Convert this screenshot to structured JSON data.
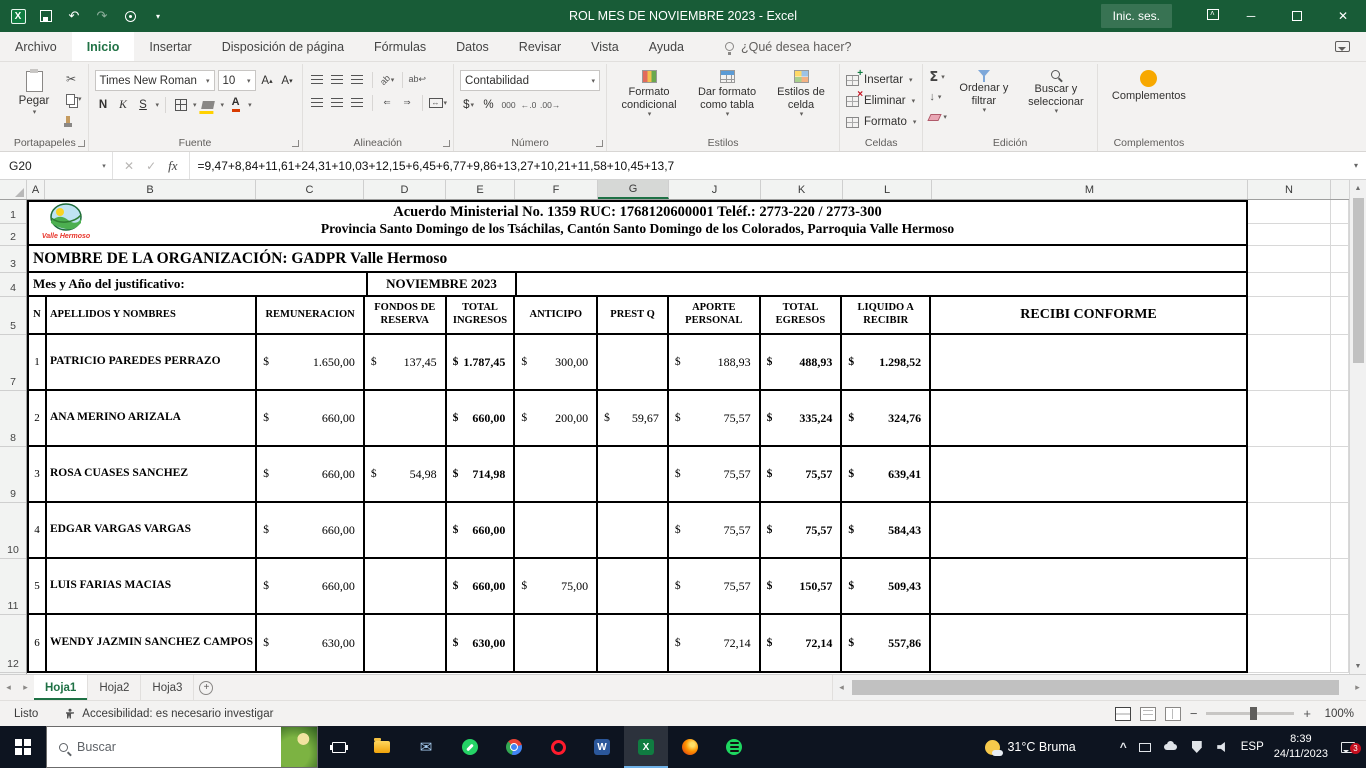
{
  "colors": {
    "excel_dark_green": "#185c37",
    "excel_green": "#217346",
    "taskbar_bg": "#0d1420",
    "addins_dot": "#f7a800"
  },
  "title_bar": {
    "title": "ROL MES DE NOVIEMBRE 2023  -  Excel",
    "sign_in": "Inic. ses."
  },
  "ribbon_tabs": {
    "items": [
      "Archivo",
      "Inicio",
      "Insertar",
      "Disposición de página",
      "Fórmulas",
      "Datos",
      "Revisar",
      "Vista",
      "Ayuda"
    ],
    "active": "Inicio",
    "tell_me": "¿Qué desea hacer?"
  },
  "ribbon": {
    "paste": "Pegar",
    "clipboard_label": "Portapapeles",
    "font_name": "Times New Roman",
    "font_size": "10",
    "bold": "N",
    "italic": "K",
    "underline": "S",
    "font_label": "Fuente",
    "wrap": "ab",
    "alignment_label": "Alineación",
    "number_format": "Contabilidad",
    "currency": "$",
    "percent": "%",
    "thousands": "000",
    "inc_decimal": "←.0",
    "dec_decimal": ".00→",
    "number_label": "Número",
    "conditional_format": "Formato condicional",
    "format_as_table": "Dar formato como tabla",
    "cell_styles": "Estilos de celda",
    "styles_label": "Estilos",
    "insert": "Insertar",
    "delete": "Eliminar",
    "format": "Formato",
    "cells_label": "Celdas",
    "sort_filter": "Ordenar y filtrar",
    "find_select": "Buscar y seleccionar",
    "editing_label": "Edición",
    "addins": "Complementos",
    "addins_label": "Complementos"
  },
  "formula_bar": {
    "name_box": "G20",
    "cancel": "✕",
    "enter": "✓",
    "fx": "fx",
    "formula": "=9,47+8,84+11,61+24,31+10,03+12,15+6,45+6,77+9,86+13,27+10,21+11,58+10,45+13,7"
  },
  "sheet": {
    "columns": [
      "A",
      "B",
      "C",
      "D",
      "E",
      "F",
      "G",
      "J",
      "K",
      "L",
      "M",
      "N"
    ],
    "selected_column": "G",
    "rows": [
      "1",
      "2",
      "3",
      "4",
      "5",
      "7",
      "8",
      "9",
      "10",
      "11",
      "12"
    ],
    "doc_header": {
      "line1": "Acuerdo Ministerial No. 1359 RUC: 1768120600001 Teléf.: 2773-220 / 2773-300",
      "line2": "Provincia Santo Domingo de los Tsáchilas, Cantón Santo Domingo de los Colorados, Parroquia Valle Hermoso",
      "org": "NOMBRE DE LA ORGANIZACIÓN: GADPR Valle Hermoso",
      "period_label": "Mes y Año del justificativo:",
      "period_value": "NOVIEMBRE 2023",
      "logo_caption": "Valle Hermoso"
    },
    "table": {
      "headers": [
        "N",
        "APELLIDOS Y NOMBRES",
        "REMUNERACION",
        "FONDOS DE RESERVA",
        "TOTAL INGRESOS",
        "ANTICIPO",
        "PREST Q",
        "APORTE PERSONAL",
        "TOTAL EGRESOS",
        "LIQUIDO A RECIBIR",
        "RECIBI CONFORME"
      ],
      "rows": [
        {
          "n": "1",
          "name": "PATRICIO PAREDES PERRAZO",
          "remuneracion": "1.650,00",
          "fondos": "137,45",
          "ingresos": "1.787,45",
          "anticipo": "300,00",
          "prest": "",
          "aporte": "188,93",
          "egresos": "488,93",
          "liquido": "1.298,52",
          "recibi": ""
        },
        {
          "n": "2",
          "name": "ANA MERINO ARIZALA",
          "remuneracion": "660,00",
          "fondos": "",
          "ingresos": "660,00",
          "anticipo": "200,00",
          "prest": "59,67",
          "aporte": "75,57",
          "egresos": "335,24",
          "liquido": "324,76",
          "recibi": ""
        },
        {
          "n": "3",
          "name": "ROSA CUASES SANCHEZ",
          "remuneracion": "660,00",
          "fondos": "54,98",
          "ingresos": "714,98",
          "anticipo": "",
          "prest": "",
          "aporte": "75,57",
          "egresos": "75,57",
          "liquido": "639,41",
          "recibi": ""
        },
        {
          "n": "4",
          "name": "EDGAR VARGAS VARGAS",
          "remuneracion": "660,00",
          "fondos": "",
          "ingresos": "660,00",
          "anticipo": "",
          "prest": "",
          "aporte": "75,57",
          "egresos": "75,57",
          "liquido": "584,43",
          "recibi": ""
        },
        {
          "n": "5",
          "name": "LUIS FARIAS MACIAS",
          "remuneracion": "660,00",
          "fondos": "",
          "ingresos": "660,00",
          "anticipo": "75,00",
          "prest": "",
          "aporte": "75,57",
          "egresos": "150,57",
          "liquido": "509,43",
          "recibi": ""
        },
        {
          "n": "6",
          "name": "WENDY JAZMIN SANCHEZ CAMPOS",
          "remuneracion": "630,00",
          "fondos": "",
          "ingresos": "630,00",
          "anticipo": "",
          "prest": "",
          "aporte": "72,14",
          "egresos": "72,14",
          "liquido": "557,86",
          "recibi": ""
        }
      ]
    }
  },
  "sheet_tabs": {
    "tabs": [
      "Hoja1",
      "Hoja2",
      "Hoja3"
    ],
    "active": "Hoja1"
  },
  "status_bar": {
    "mode": "Listo",
    "accessibility": "Accesibilidad: es necesario investigar",
    "zoom": "100%"
  },
  "taskbar": {
    "search_placeholder": "Buscar",
    "apps": [
      "file-explorer",
      "mail",
      "whatsapp",
      "chrome",
      "opera",
      "word",
      "excel",
      "firefox",
      "spotify"
    ],
    "active_app": "excel",
    "weather": "31°C Bruma",
    "language": "ESP",
    "time": "8:39",
    "date": "24/11/2023",
    "notification_count": "3"
  }
}
